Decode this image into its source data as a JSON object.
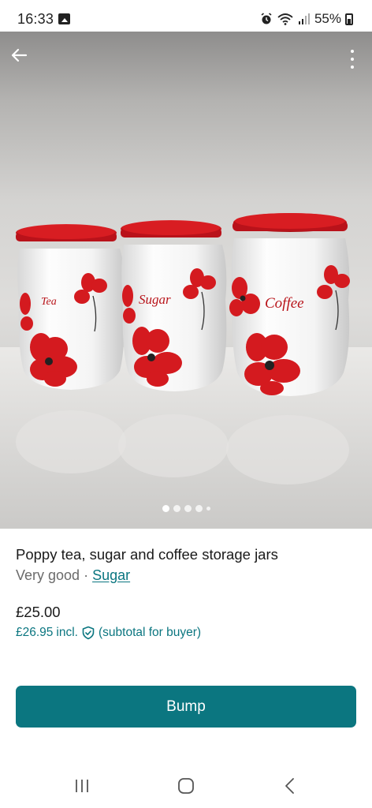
{
  "status_bar": {
    "time": "16:33",
    "battery": "55%",
    "icons": [
      "gallery-notification-icon",
      "alarm-icon",
      "wifi-icon",
      "signal-icon",
      "battery-icon"
    ]
  },
  "photo": {
    "jar_labels": [
      "Tea",
      "Sugar",
      "Coffee"
    ],
    "carousel": {
      "total_dots": 5,
      "active_index": 0
    },
    "icons": {
      "back": "arrow-left-icon",
      "menu": "more-vertical-icon"
    }
  },
  "listing": {
    "title": "Poppy tea, sugar and coffee storage jars",
    "condition": "Very good",
    "separator": " · ",
    "brand": "Sugar",
    "price": "£25.00",
    "buyer_price": "£26.95",
    "buyer_incl": "incl.",
    "buyer_note": "(subtotal for buyer)"
  },
  "actions": {
    "bump_label": "Bump"
  },
  "navigation": {
    "icons": [
      "recent-apps-icon",
      "home-icon",
      "back-icon"
    ]
  },
  "colors": {
    "accent": "#0b7680",
    "lid_red": "#c8151b",
    "poppy_red": "#d41a1f"
  }
}
